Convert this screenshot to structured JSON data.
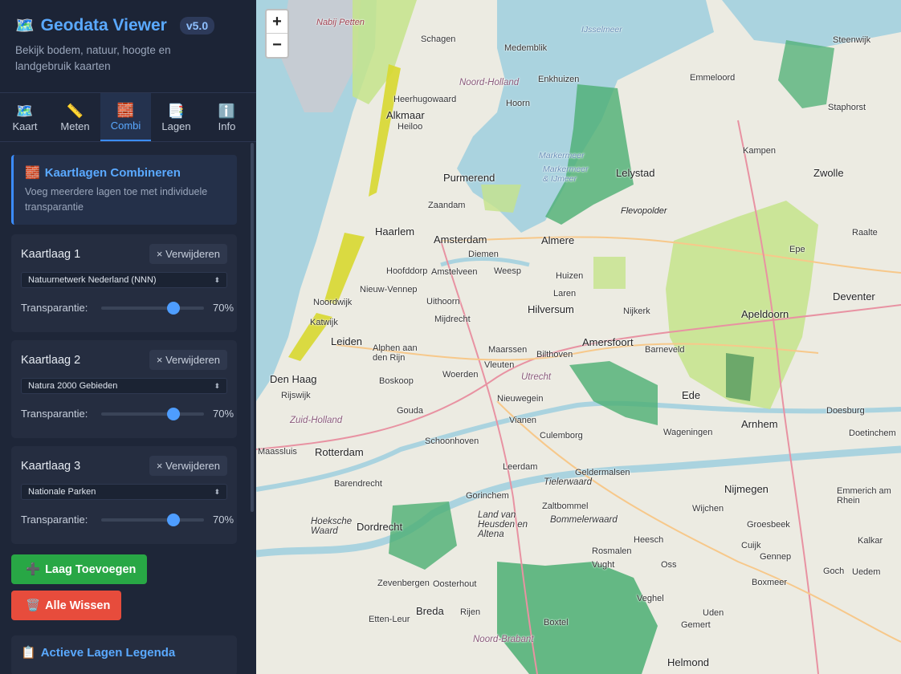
{
  "app": {
    "icon": "map-icon",
    "title": "Geodata Viewer",
    "version": "v5.0",
    "subtitle": "Bekijk bodem, natuur, hoogte en landgebruik kaarten"
  },
  "tabs": [
    {
      "icon": "map-icon",
      "label": "Kaart"
    },
    {
      "icon": "ruler-icon",
      "label": "Meten"
    },
    {
      "icon": "stack-icon",
      "label": "Combi"
    },
    {
      "icon": "layers-icon",
      "label": "Lagen"
    },
    {
      "icon": "info-icon",
      "label": "Info"
    }
  ],
  "active_tab": "Combi",
  "combine": {
    "title": "Kaartlagen Combineren",
    "description": "Voeg meerdere lagen toe met individuele transparantie"
  },
  "layers": [
    {
      "name": "Kaartlaag 1",
      "remove_label": "× Verwijderen",
      "selected": "Natuurnetwerk Nederland (NNN)",
      "transparency_label": "Transparantie:",
      "transparency": 70,
      "transparency_text": "70%"
    },
    {
      "name": "Kaartlaag 2",
      "remove_label": "× Verwijderen",
      "selected": "Natura 2000 Gebieden",
      "transparency_label": "Transparantie:",
      "transparency": 70,
      "transparency_text": "70%"
    },
    {
      "name": "Kaartlaag 3",
      "remove_label": "× Verwijderen",
      "selected": "Nationale Parken",
      "transparency_label": "Transparantie:",
      "transparency": 70,
      "transparency_text": "70%"
    }
  ],
  "buttons": {
    "add_layer": "Laag Toevoegen",
    "clear_all": "Alle Wissen"
  },
  "legend": {
    "title": "Actieve Lagen Legenda"
  },
  "map": {
    "zoom_in": "+",
    "zoom_out": "−",
    "places": [
      "Nabij Petten",
      "IJsselmeer",
      "Schagen",
      "Medemblik",
      "Noord-Holland",
      "Enkhuizen",
      "Heerhugowaard",
      "Hoorn",
      "Alkmaar",
      "Heiloo",
      "Markermeer",
      "Markermeer & IJmeer",
      "Lelystad",
      "Purmerend",
      "Zaandam",
      "Flevopolder",
      "Amsterdam",
      "Almere",
      "Haarlem",
      "Diemen",
      "Hoofddorp",
      "Amstelveen",
      "Weesp",
      "Huizen",
      "Nieuw-Vennep",
      "Hilversum",
      "Noordwijk",
      "Uithoorn",
      "Laren",
      "Nijkerk",
      "Katwijk",
      "Mijdrecht",
      "Leiden",
      "Alphen aan den Rijn",
      "Maarssen",
      "Bilthoven",
      "Amersfoort",
      "Barneveld",
      "Den Haag",
      "Boskoop",
      "Woerden",
      "Utrecht",
      "Vleuten",
      "Rijswijk",
      "Nieuwegein",
      "Zuid-Holland",
      "Gouda",
      "Vianen",
      "Culemborg",
      "Rotterdam",
      "Schoonhoven",
      "Leerdam",
      "Geldermalsen",
      "Tielerwaard",
      "Maassluis",
      "Barendrecht",
      "Gorinchem",
      "Zaltbommel",
      "Land van Heusden en Altena",
      "Bommelerwaard",
      "Dordrecht",
      "Hoeksche Waard",
      "Heesch",
      "Oosterhout",
      "Breda",
      "Noord-Brabant",
      "Zevenbergen",
      "Etten-Leur",
      "Rijen",
      "Helmond",
      "Arnhem",
      "Nijmegen",
      "Ede",
      "Wageningen",
      "Apeldoorn",
      "Deventer",
      "Zwolle",
      "Kampen",
      "Emmeloord",
      "Steenwijk",
      "Staphorst",
      "Epe",
      "Raalte",
      "Wijchen",
      "Groesbeek",
      "Cuijk",
      "Boxmeer",
      "Gennep",
      "Goch",
      "Uedem",
      "Kalkar",
      "Emmerich am Rhein",
      "Doetinchem",
      "Doesburg",
      "Rosmalen",
      "Vught",
      "Veghel",
      "Uden",
      "Gemert",
      "Boxtel",
      "Oss",
      "Barneveld"
    ]
  }
}
